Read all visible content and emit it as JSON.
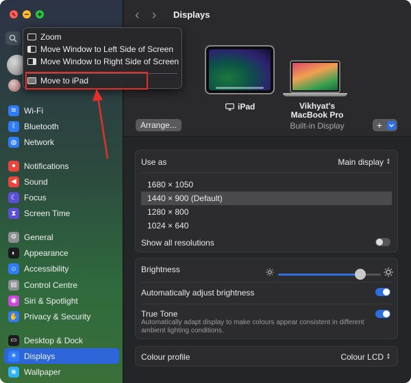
{
  "window": {
    "title": "Displays"
  },
  "sidebar": {
    "items": [
      {
        "label": "Wi-Fi",
        "icon": "wifi-icon",
        "color": "#2f7cf6",
        "group": 1
      },
      {
        "label": "Bluetooth",
        "icon": "bluetooth-icon",
        "color": "#2f7cf6",
        "group": 1
      },
      {
        "label": "Network",
        "icon": "globe-icon",
        "color": "#2f7cf6",
        "group": 1
      },
      {
        "label": "Notifications",
        "icon": "bell-icon",
        "color": "#e8453c",
        "group": 2
      },
      {
        "label": "Sound",
        "icon": "speaker-icon",
        "color": "#e8453c",
        "group": 2
      },
      {
        "label": "Focus",
        "icon": "moon-icon",
        "color": "#5b4fd8",
        "group": 2
      },
      {
        "label": "Screen Time",
        "icon": "hourglass-icon",
        "color": "#5b4fd8",
        "group": 2
      },
      {
        "label": "General",
        "icon": "gear-icon",
        "color": "#8e8e93",
        "group": 3
      },
      {
        "label": "Appearance",
        "icon": "appearance-icon",
        "color": "#1c1c1e",
        "group": 3
      },
      {
        "label": "Accessibility",
        "icon": "accessibility-icon",
        "color": "#2f7cf6",
        "group": 3
      },
      {
        "label": "Control Centre",
        "icon": "control-centre-icon",
        "color": "#8e8e93",
        "group": 3
      },
      {
        "label": "Siri & Spotlight",
        "icon": "siri-icon",
        "color": "#c94ad6",
        "group": 3
      },
      {
        "label": "Privacy & Security",
        "icon": "hand-icon",
        "color": "#2f7cf6",
        "group": 3
      },
      {
        "label": "Desktop & Dock",
        "icon": "dock-icon",
        "color": "#1c1c1e",
        "group": 4
      },
      {
        "label": "Displays",
        "icon": "sun-icon",
        "color": "#2f7cf6",
        "group": 4,
        "active": true
      },
      {
        "label": "Wallpaper",
        "icon": "wallpaper-icon",
        "color": "#2fb2f6",
        "group": 4
      }
    ]
  },
  "context_menu": {
    "items": [
      "Zoom",
      "Move Window to Left Side of Screen",
      "Move Window to Right Side of Screen",
      "Move to iPad"
    ]
  },
  "displays": {
    "ipad_label": "iPad",
    "mac_label": "Vikhyat's MacBook Pro",
    "mac_sub": "Built-in Display",
    "arrange_label": "Arrange...",
    "add_label": "+"
  },
  "settings": {
    "use_as_label": "Use as",
    "use_as_value": "Main display",
    "resolutions": [
      "1680 × 1050",
      "1440 × 900 (Default)",
      "1280 × 800",
      "1024 × 640"
    ],
    "selected_resolution_index": 1,
    "show_all_label": "Show all resolutions",
    "show_all_on": false,
    "brightness_label": "Brightness",
    "brightness_level": 0.8,
    "auto_brightness_label": "Automatically adjust brightness",
    "auto_brightness_on": true,
    "true_tone_label": "True Tone",
    "true_tone_desc": "Automatically adapt display to make colours appear consistent in different ambient lighting conditions.",
    "true_tone_on": true,
    "colour_profile_label": "Colour profile",
    "colour_profile_value": "Colour LCD"
  },
  "annotation_color": "#e5302a"
}
